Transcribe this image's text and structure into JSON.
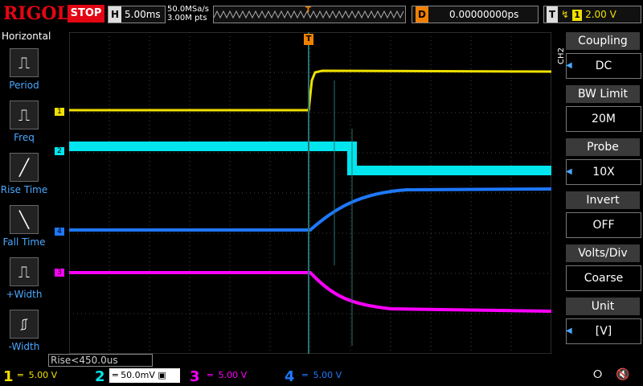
{
  "brand": "RIGOL",
  "run_state": "STOP",
  "timebase": {
    "label": "H",
    "value": "5.00ms"
  },
  "sample": {
    "rate": "50.0MSa/s",
    "points": "3.00M pts"
  },
  "delay": {
    "label": "D",
    "value": "0.00000000ps"
  },
  "trigger": {
    "label": "T",
    "edge_icon": "rising-edge-icon",
    "source": "1",
    "level": "2.00 V"
  },
  "left_panel": {
    "title": "Horizontal",
    "items": [
      {
        "label": "Period",
        "icon": "period-icon"
      },
      {
        "label": "Freq",
        "icon": "freq-icon"
      },
      {
        "label": "Rise Time",
        "icon": "rise-time-icon"
      },
      {
        "label": "Fall Time",
        "icon": "fall-time-icon"
      },
      {
        "label": "+Width",
        "icon": "plus-width-icon"
      },
      {
        "label": "-Width",
        "icon": "minus-width-icon"
      }
    ]
  },
  "right_panel": {
    "channel_tag": "CH2",
    "items": [
      {
        "title": "Coupling",
        "value": "DC"
      },
      {
        "title": "BW Limit",
        "value": "20M"
      },
      {
        "title": "Probe",
        "value": "10X"
      },
      {
        "title": "Invert",
        "value": "OFF"
      },
      {
        "title": "Volts/Div",
        "value": "Coarse"
      },
      {
        "title": "Unit",
        "value": "[V]"
      }
    ]
  },
  "measurement": "Rise<450.0us",
  "channels": [
    {
      "num": "1",
      "scale": "5.00 V",
      "color": "#f0e000"
    },
    {
      "num": "2",
      "scale": "50.0mV",
      "color": "#00e5ee"
    },
    {
      "num": "3",
      "scale": "5.00 V",
      "color": "#ff00ff"
    },
    {
      "num": "4",
      "scale": "5.00 V",
      "color": "#1e78ff"
    }
  ],
  "trace_markers": [
    {
      "label": "1",
      "color": "#f0e000"
    },
    {
      "label": "2",
      "color": "#00e5ee"
    },
    {
      "label": "4",
      "color": "#1e78ff"
    },
    {
      "label": "3",
      "color": "#ff00ff"
    }
  ],
  "trigger_marker": "T",
  "colors": {
    "accent": "#e30613",
    "trigger": "#f08000",
    "menu_arrow": "#4aa8ff"
  }
}
